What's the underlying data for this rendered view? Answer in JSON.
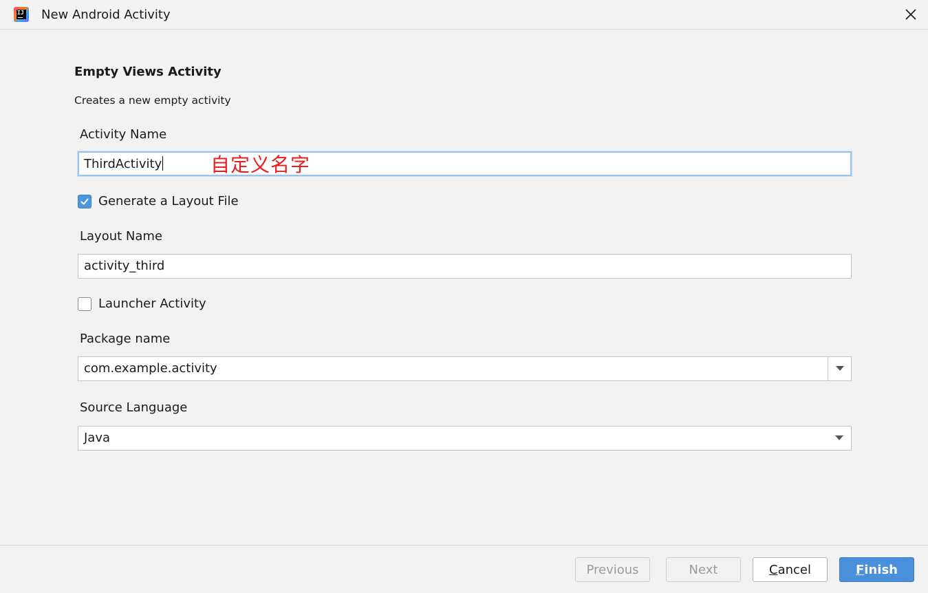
{
  "window": {
    "title": "New Android Activity",
    "app_logo_text": "IJ"
  },
  "template": {
    "heading": "Empty Views Activity",
    "description": "Creates a new empty activity"
  },
  "form": {
    "activity_name": {
      "label": "Activity Name",
      "value": "ThirdActivity",
      "annotation": "自定义名字"
    },
    "generate_layout": {
      "label": "Generate a Layout File",
      "checked": true
    },
    "layout_name": {
      "label": "Layout Name",
      "value": "activity_third"
    },
    "launcher_activity": {
      "label": "Launcher Activity",
      "checked": false
    },
    "package_name": {
      "label": "Package name",
      "value": "com.example.activity"
    },
    "source_language": {
      "label": "Source Language",
      "value": "Java"
    }
  },
  "footer": {
    "previous": "Previous",
    "next": "Next",
    "cancel_mnemonic": "C",
    "cancel_rest": "ancel",
    "finish_mnemonic": "F",
    "finish_rest": "inish"
  },
  "colors": {
    "accent": "#4a8fda",
    "annotation": "#ee1c1c",
    "focus_border": "#97c3ec"
  }
}
